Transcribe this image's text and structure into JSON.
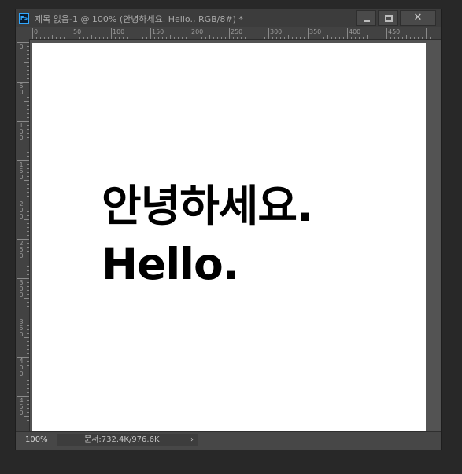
{
  "window": {
    "app_icon": "Ps",
    "title": "제목 없음-1 @ 100% (안녕하세요. Hello., RGB/8#) *",
    "close_glyph": "✕"
  },
  "rulers": {
    "top_labels": [
      "0",
      "50",
      "100",
      "150",
      "200",
      "250",
      "300",
      "350",
      "400",
      "450"
    ],
    "left_labels": [
      "0",
      "50",
      "100",
      "150",
      "200",
      "250",
      "300",
      "350",
      "400",
      "450"
    ]
  },
  "canvas": {
    "line1": "안녕하세요.",
    "line2": "Hello."
  },
  "status": {
    "zoom": "100%",
    "doc_info": "문서:732.4K/976.6K",
    "arrow": "›"
  },
  "icons": [
    "photoshop-app-icon",
    "minimize-icon",
    "maximize-icon",
    "close-icon"
  ]
}
